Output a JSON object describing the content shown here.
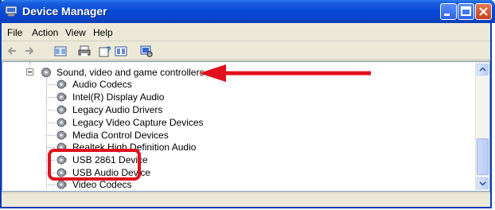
{
  "window": {
    "title": "Device Manager"
  },
  "menu": {
    "items": [
      "File",
      "Action",
      "View",
      "Help"
    ]
  },
  "toolbar": {
    "icons": [
      "back-icon",
      "forward-icon",
      "properties-view-icon",
      "print-icon",
      "help-icon",
      "view-icon",
      "scan-hardware-icon"
    ]
  },
  "tree": {
    "category": "Sound, video and game controllers",
    "devices": [
      "Audio Codecs",
      "Intel(R) Display Audio",
      "Legacy Audio Drivers",
      "Legacy Video Capture Devices",
      "Media Control Devices",
      "Realtek High Definition Audio",
      "USB 2861 Device",
      "USB Audio Device",
      "Video Codecs"
    ]
  },
  "annotations": {
    "arrow_color": "#e0101e",
    "box_color": "#e0101e"
  },
  "colors": {
    "titlebar": "#0a46cf",
    "window_bg": "#ece9d8"
  }
}
